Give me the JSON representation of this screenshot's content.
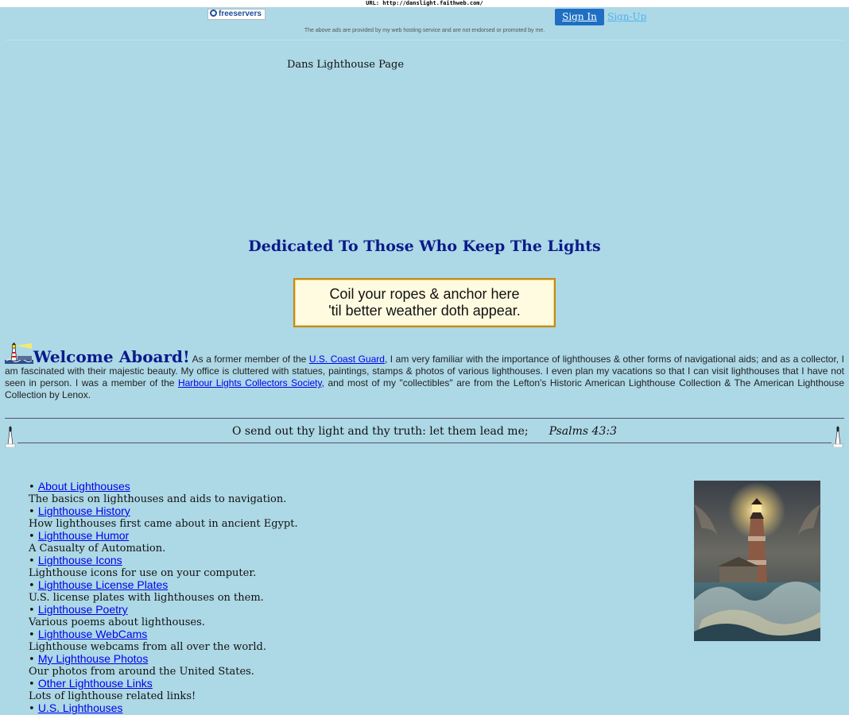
{
  "url_bar": "URL: http://danslight.faithweb.com/",
  "header": {
    "logo_text": "freeservers",
    "sign_in": "Sign In",
    "sign_up": "Sign-Up",
    "disclaimer": "The above ads are provided by my web hosting service and are not endorsed or promoted by me."
  },
  "page_title": "Dans Lighthouse Page",
  "dedication": "Dedicated To Those Who Keep The Lights",
  "quote": {
    "line1": "Coil your ropes & anchor here",
    "line2": "'til better weather doth appear."
  },
  "welcome": {
    "heading": "Welcome Aboard!",
    "text1": " As a former member of the ",
    "link1": "U.S. Coast Guard",
    "text2": ", I am very familiar with the importance of lighthouses & other forms of navigational aids; and as a collector, I am fascinated with their majestic beauty. My office is cluttered with statues, paintings, stamps & photos of various lighthouses. I even plan my vacations so that I can visit lighthouses that I have not seen in person. I was a member of the ",
    "link2": "Harbour Lights Collectors Society",
    "text3": ", and most of my \"collectibles\" are from the Lefton's Historic American Lighthouse Collection & The American Lighthouse Collection by Lenox."
  },
  "psalm": {
    "verse": "O send out thy light and thy truth: let them lead me;",
    "reference": "Psalms 43:3"
  },
  "links": [
    {
      "label": "About Lighthouses",
      "desc": "The basics on lighthouses and aids to navigation."
    },
    {
      "label": "Lighthouse History",
      "desc": "How lighthouses first came about in ancient Egypt."
    },
    {
      "label": "Lighthouse Humor",
      "desc": "A Casualty of Automation."
    },
    {
      "label": "Lighthouse Icons",
      "desc": "Lighthouse icons for use on your computer."
    },
    {
      "label": "Lighthouse License Plates",
      "desc": "U.S. license plates with lighthouses on them."
    },
    {
      "label": "Lighthouse Poetry",
      "desc": "Various poems about lighthouses."
    },
    {
      "label": "Lighthouse WebCams",
      "desc": "Lighthouse webcams from all over the world."
    },
    {
      "label": "My Lighthouse Photos",
      "desc": "Our photos from around the United States."
    },
    {
      "label": "Other Lighthouse Links",
      "desc": "Lots of lighthouse related links!"
    },
    {
      "label": "U.S. Lighthouses",
      "desc": ""
    }
  ],
  "bullet": "•"
}
